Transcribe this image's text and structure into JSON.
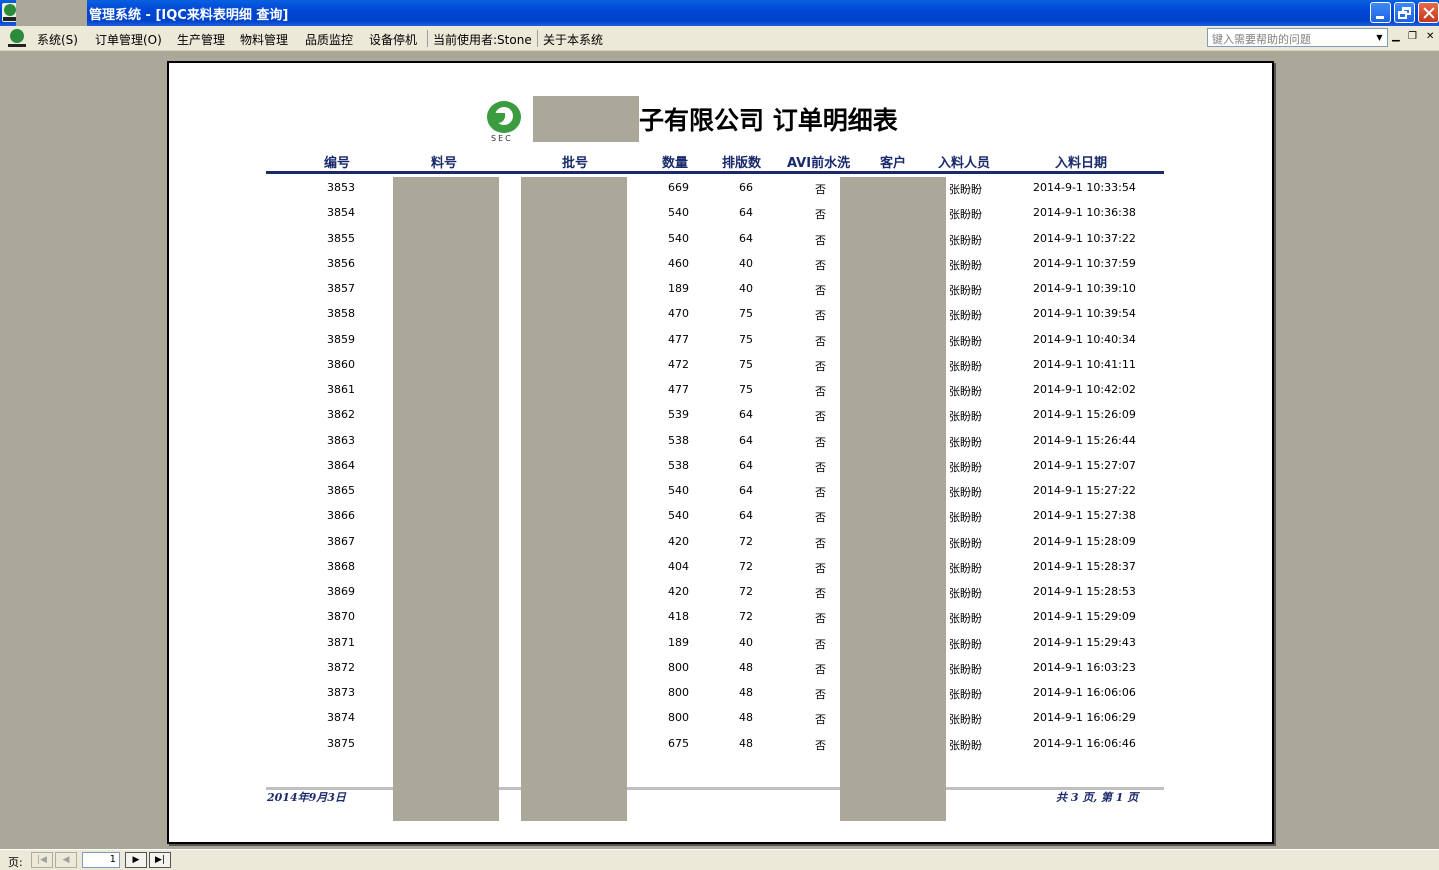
{
  "window": {
    "title": "管理系统 - [IQC来料表明细 查询]"
  },
  "menu": {
    "items": [
      "系统(S)",
      "订单管理(O)",
      "生产管理",
      "物料管理",
      "品质监控",
      "设备停机"
    ],
    "current_user": "当前使用者:Stone",
    "about": "关于本系统",
    "help_placeholder": "键入需要帮助的问题"
  },
  "report": {
    "logo_text": "SEC",
    "title": "子有限公司  订单明细表",
    "headers": {
      "id": "编号",
      "material": "料号",
      "batch": "批号",
      "qty": "数量",
      "panels": "排版数",
      "avi": "AVI前水洗",
      "customer": "客户",
      "person": "入料人员",
      "date": "入料日期"
    },
    "rows": [
      {
        "id": "3853",
        "qty": "669",
        "panels": "66",
        "avi": "否",
        "person": "张盼盼",
        "date": "2014-9-1 10:33:54"
      },
      {
        "id": "3854",
        "qty": "540",
        "panels": "64",
        "avi": "否",
        "person": "张盼盼",
        "date": "2014-9-1 10:36:38"
      },
      {
        "id": "3855",
        "qty": "540",
        "panels": "64",
        "avi": "否",
        "person": "张盼盼",
        "date": "2014-9-1 10:37:22"
      },
      {
        "id": "3856",
        "qty": "460",
        "panels": "40",
        "avi": "否",
        "person": "张盼盼",
        "date": "2014-9-1 10:37:59"
      },
      {
        "id": "3857",
        "qty": "189",
        "panels": "40",
        "avi": "否",
        "person": "张盼盼",
        "date": "2014-9-1 10:39:10"
      },
      {
        "id": "3858",
        "qty": "470",
        "panels": "75",
        "avi": "否",
        "person": "张盼盼",
        "date": "2014-9-1 10:39:54"
      },
      {
        "id": "3859",
        "qty": "477",
        "panels": "75",
        "avi": "否",
        "person": "张盼盼",
        "date": "2014-9-1 10:40:34"
      },
      {
        "id": "3860",
        "qty": "472",
        "panels": "75",
        "avi": "否",
        "person": "张盼盼",
        "date": "2014-9-1 10:41:11"
      },
      {
        "id": "3861",
        "qty": "477",
        "panels": "75",
        "avi": "否",
        "person": "张盼盼",
        "date": "2014-9-1 10:42:02"
      },
      {
        "id": "3862",
        "qty": "539",
        "panels": "64",
        "avi": "否",
        "person": "张盼盼",
        "date": "2014-9-1 15:26:09"
      },
      {
        "id": "3863",
        "qty": "538",
        "panels": "64",
        "avi": "否",
        "person": "张盼盼",
        "date": "2014-9-1 15:26:44"
      },
      {
        "id": "3864",
        "qty": "538",
        "panels": "64",
        "avi": "否",
        "person": "张盼盼",
        "date": "2014-9-1 15:27:07"
      },
      {
        "id": "3865",
        "qty": "540",
        "panels": "64",
        "avi": "否",
        "person": "张盼盼",
        "date": "2014-9-1 15:27:22"
      },
      {
        "id": "3866",
        "qty": "540",
        "panels": "64",
        "avi": "否",
        "person": "张盼盼",
        "date": "2014-9-1 15:27:38"
      },
      {
        "id": "3867",
        "qty": "420",
        "panels": "72",
        "avi": "否",
        "person": "张盼盼",
        "date": "2014-9-1 15:28:09"
      },
      {
        "id": "3868",
        "qty": "404",
        "panels": "72",
        "avi": "否",
        "person": "张盼盼",
        "date": "2014-9-1 15:28:37"
      },
      {
        "id": "3869",
        "qty": "420",
        "panels": "72",
        "avi": "否",
        "person": "张盼盼",
        "date": "2014-9-1 15:28:53"
      },
      {
        "id": "3870",
        "qty": "418",
        "panels": "72",
        "avi": "否",
        "person": "张盼盼",
        "date": "2014-9-1 15:29:09"
      },
      {
        "id": "3871",
        "qty": "189",
        "panels": "40",
        "avi": "否",
        "person": "张盼盼",
        "date": "2014-9-1 15:29:43"
      },
      {
        "id": "3872",
        "qty": "800",
        "panels": "48",
        "avi": "否",
        "person": "张盼盼",
        "date": "2014-9-1 16:03:23"
      },
      {
        "id": "3873",
        "qty": "800",
        "panels": "48",
        "avi": "否",
        "person": "张盼盼",
        "date": "2014-9-1 16:06:06"
      },
      {
        "id": "3874",
        "qty": "800",
        "panels": "48",
        "avi": "否",
        "person": "张盼盼",
        "date": "2014-9-1 16:06:29"
      },
      {
        "id": "3875",
        "qty": "675",
        "panels": "48",
        "avi": "否",
        "person": "张盼盼",
        "date": "2014-9-1 16:06:46"
      }
    ],
    "footer_date": "2014年9月3日",
    "footer_page": "共 3 页, 第 1 页"
  },
  "pager": {
    "label": "页:",
    "current_page": "1"
  }
}
